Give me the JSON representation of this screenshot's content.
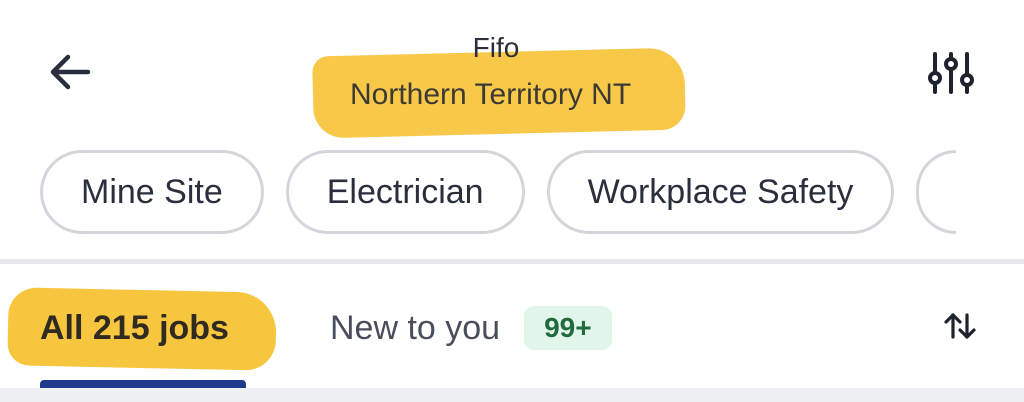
{
  "header": {
    "back_icon": "arrow-left-icon",
    "search_keyword": "Fifo",
    "search_location": "Northern Territory NT",
    "filter_icon": "sliders-icon",
    "highlight_color": "#f7c02f"
  },
  "chips": [
    {
      "label": "Mine Site"
    },
    {
      "label": "Electrician"
    },
    {
      "label": "Workplace Safety"
    }
  ],
  "tabs": {
    "all": {
      "label": "All 215 jobs",
      "active": true
    },
    "new": {
      "label": "New to you",
      "badge": "99+"
    },
    "sort_icon": "sort-arrows-icon"
  },
  "colors": {
    "accent": "#1e3a8a",
    "badge_bg": "#e2f5ea",
    "badge_text": "#1f6b3d",
    "chip_border": "#d3d5da"
  }
}
